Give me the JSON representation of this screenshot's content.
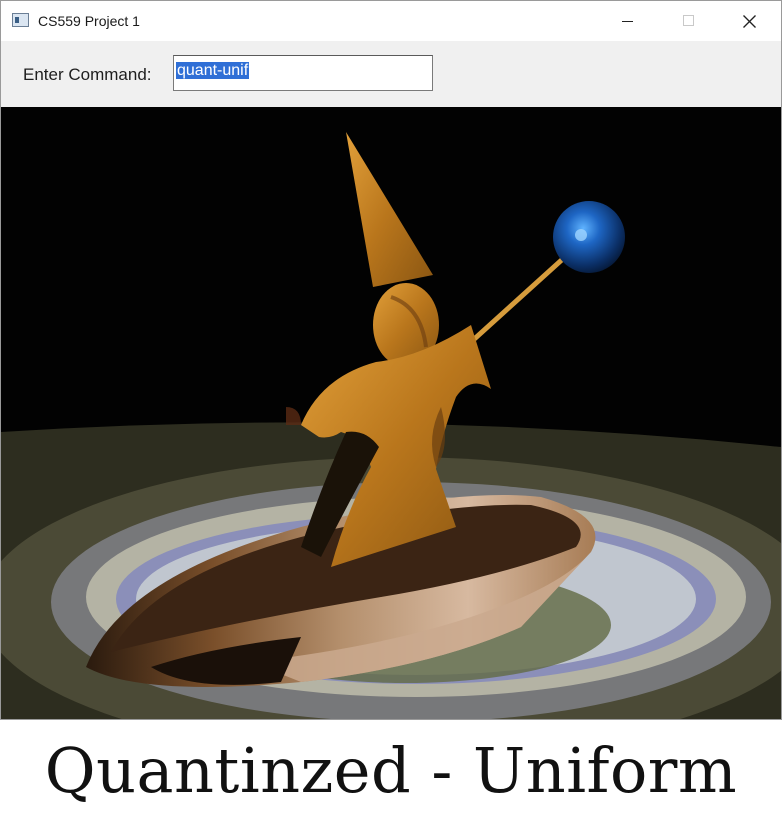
{
  "window": {
    "title": "CS559 Project 1",
    "controls": [
      "minimize-icon",
      "maximize-icon",
      "close-icon"
    ]
  },
  "toolbar": {
    "command_label": "Enter Command:",
    "command_value": "quant-unif"
  },
  "caption": "Quantinzed - Uniform",
  "colors": {
    "selection": "#2f6fd6",
    "gold": "#c98a22",
    "sphere": "#1c5fb0",
    "background": "#020202"
  }
}
